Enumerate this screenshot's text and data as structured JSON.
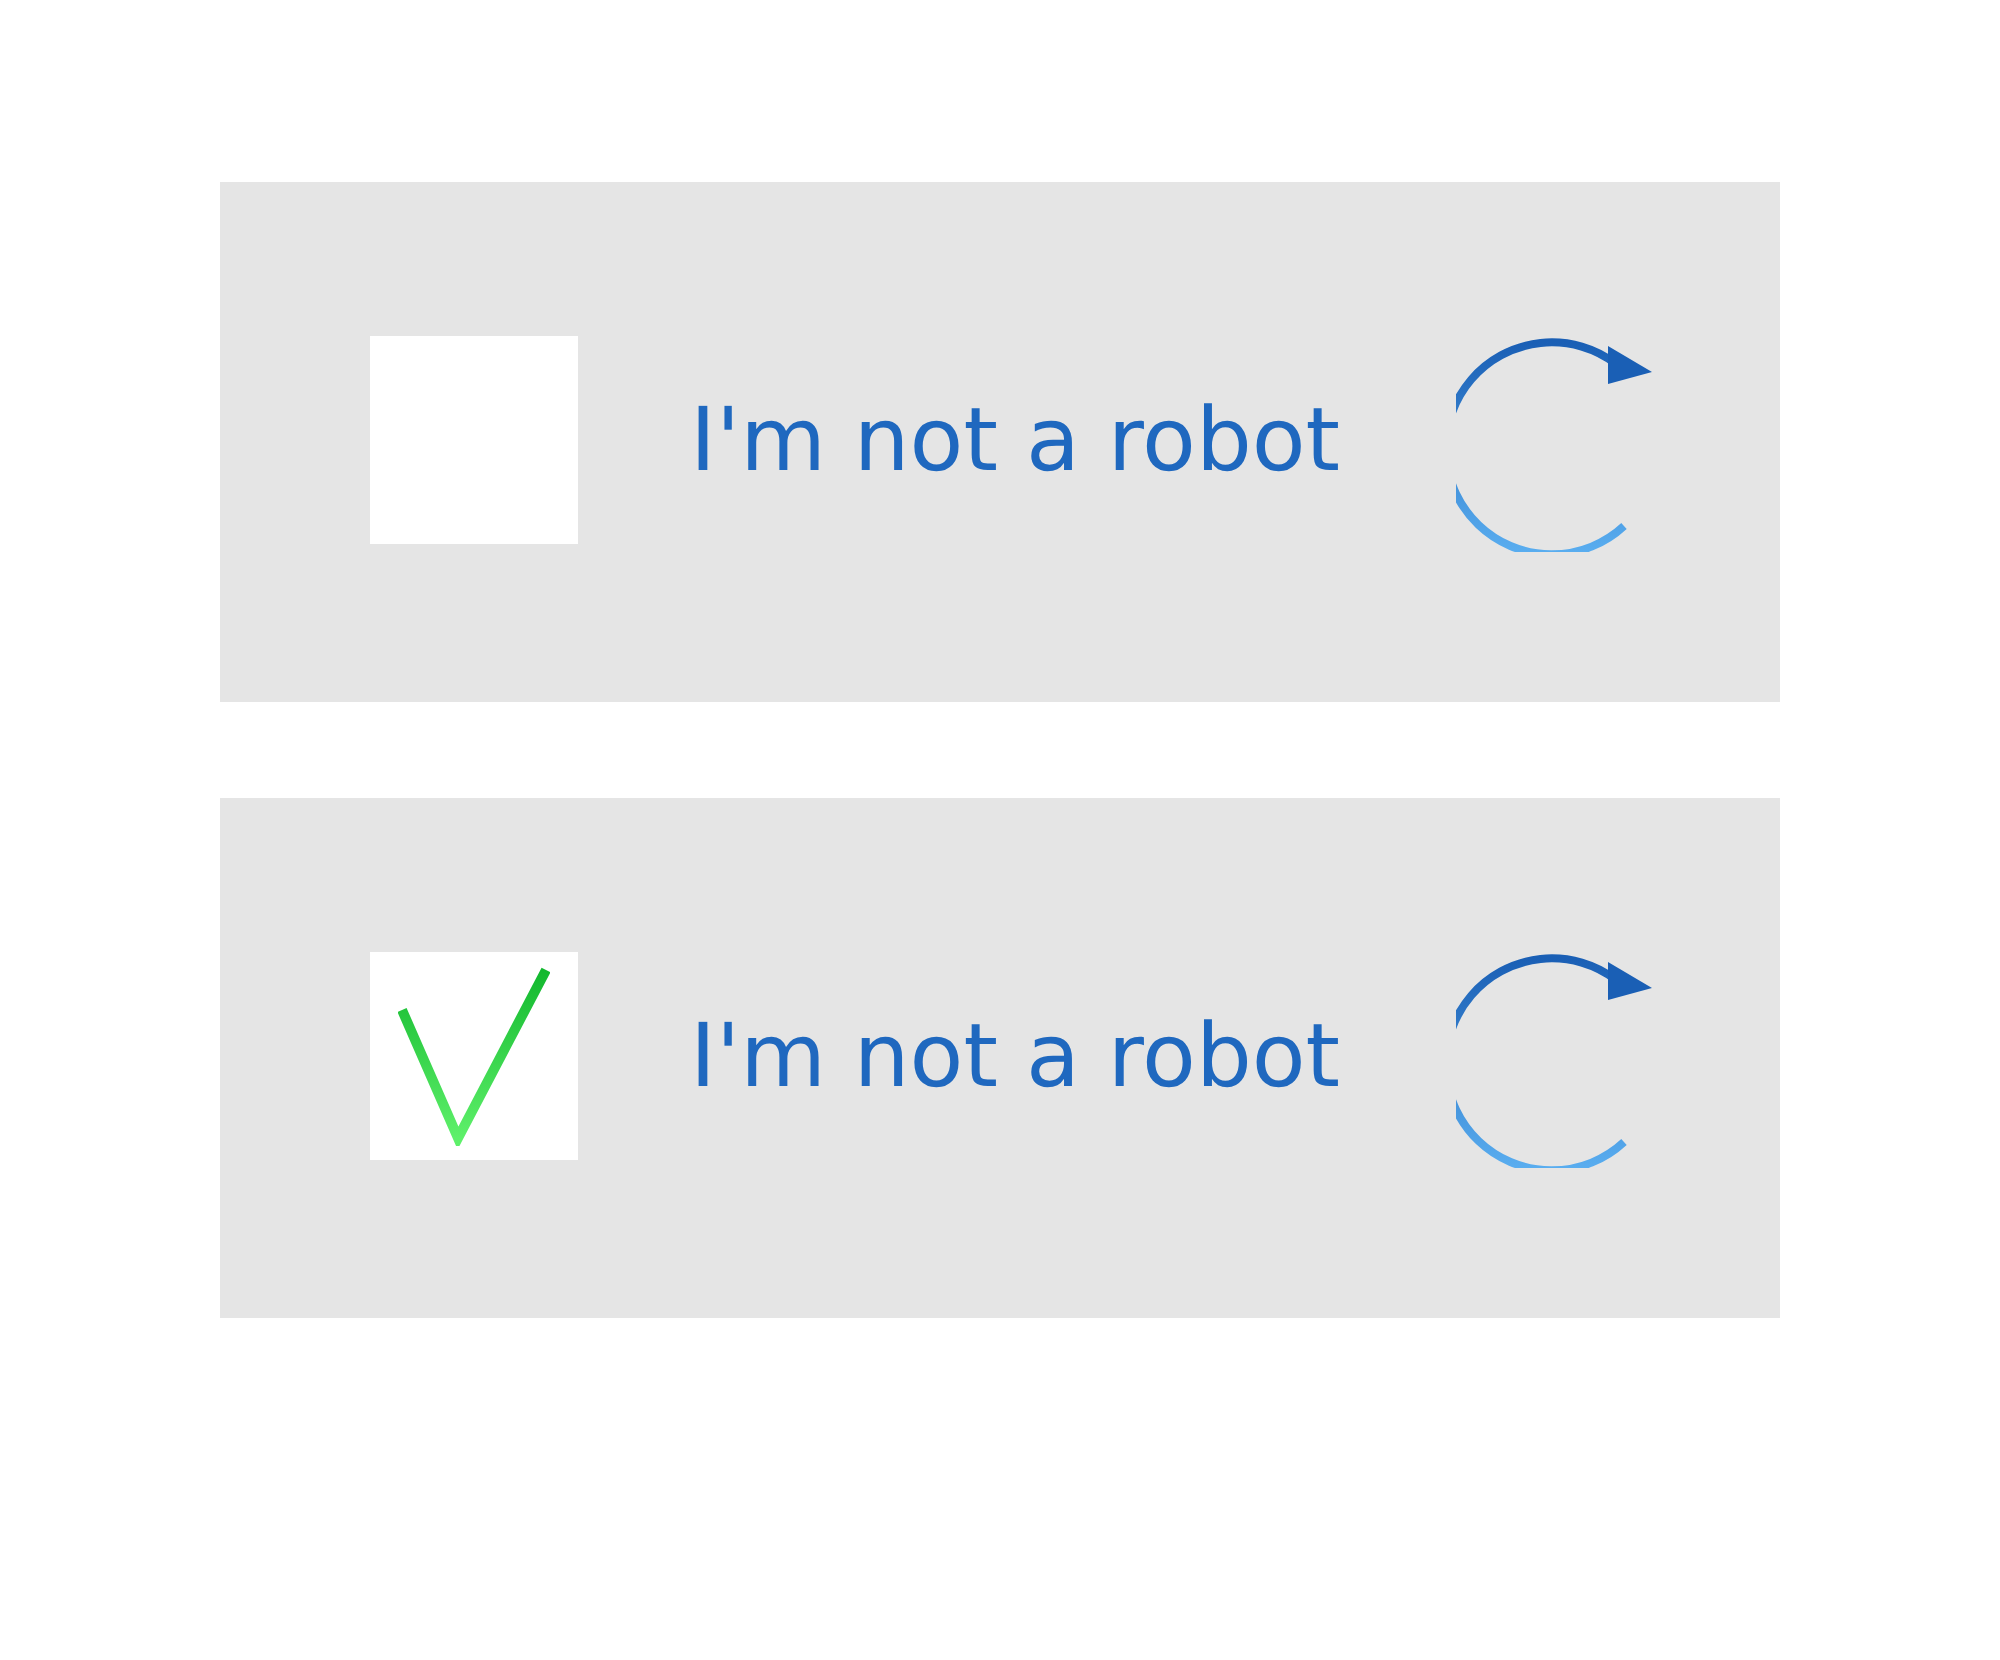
{
  "captchas": [
    {
      "label": "I'm not a robot",
      "checked": false
    },
    {
      "label": "I'm not a robot",
      "checked": true
    }
  ]
}
